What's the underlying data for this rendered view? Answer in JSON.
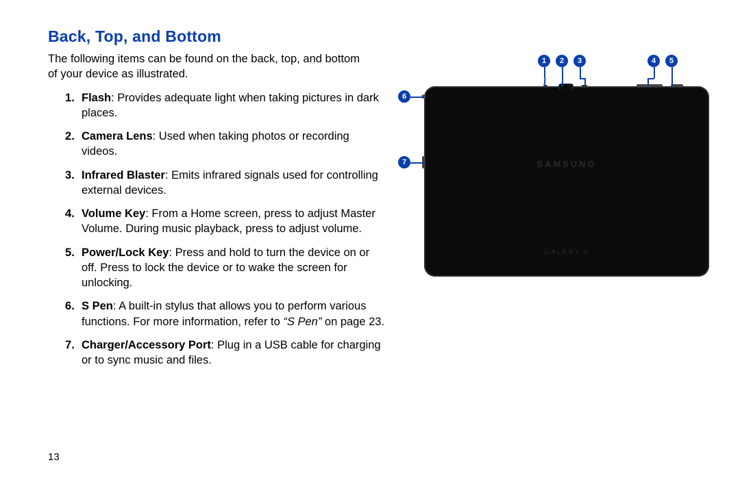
{
  "heading": "Back, Top, and Bottom",
  "intro": "The following items can be found on the back, top, and bottom of your device as illustrated.",
  "page_number": "13",
  "brand": "SAMSUNG",
  "subbrand": "GALAXY S",
  "items": [
    {
      "term": "Flash",
      "desc": ": Provides adequate light when taking pictures in dark places."
    },
    {
      "term": "Camera Lens",
      "desc": ": Used when taking photos or recording videos."
    },
    {
      "term": "Infrared Blaster",
      "desc": ": Emits infrared signals used for controlling external devices."
    },
    {
      "term": "Volume Key",
      "desc": ": From a Home screen, press to adjust Master Volume. During music playback, press to adjust volume."
    },
    {
      "term": "Power/Lock Key",
      "desc": ": Press and hold to turn the device on or off. Press to lock the device or to wake the screen for unlocking."
    },
    {
      "term": "S Pen",
      "desc": ": A built-in stylus that allows you to perform various functions. For more information, refer to ",
      "ref": "“S Pen”",
      "ref_tail": " on page 23."
    },
    {
      "term": "Charger/Accessory Port",
      "desc": ": Plug in a USB cable for charging or to sync music and files."
    }
  ],
  "callouts": {
    "c1": "1",
    "c2": "2",
    "c3": "3",
    "c4": "4",
    "c5": "5",
    "c6": "6",
    "c7": "7"
  }
}
